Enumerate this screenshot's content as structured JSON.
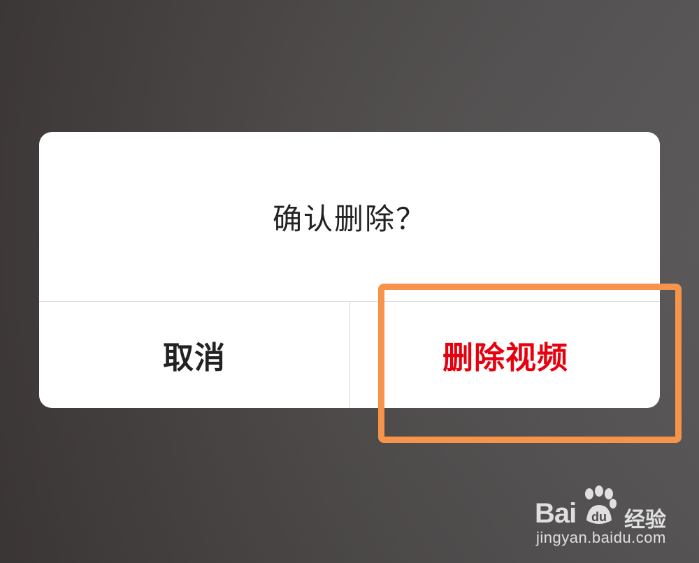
{
  "dialog": {
    "message": "确认删除？",
    "cancel_label": "取消",
    "delete_label": "删除视频"
  },
  "watermark": {
    "logo_text": "Bai",
    "logo_inner": "du",
    "product": "经验",
    "url": "jingyan.baidu.com"
  },
  "colors": {
    "delete_accent": "#e8000e",
    "highlight": "#f5944a",
    "dialog_bg": "#ffffff",
    "backdrop": "#4c4848"
  },
  "icons": {
    "watermark_paw": "baidu-paw-icon"
  }
}
